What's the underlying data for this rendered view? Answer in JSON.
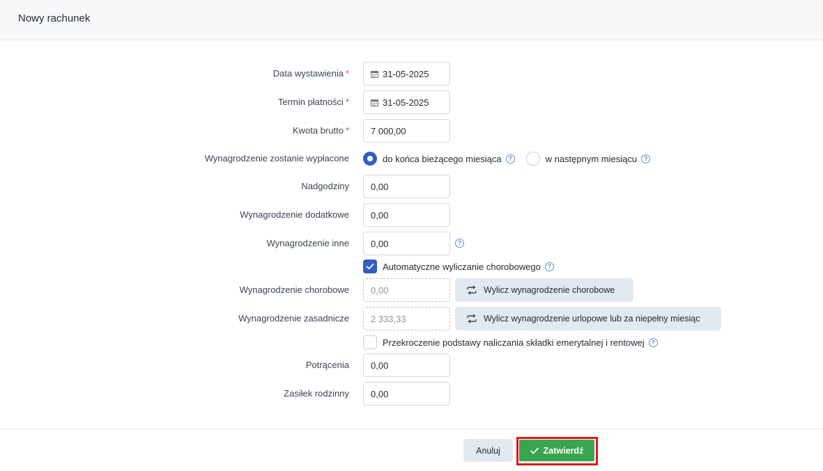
{
  "header": {
    "title": "Nowy rachunek"
  },
  "form": {
    "issue_date": {
      "label": "Data wystawienia",
      "required": "*",
      "value": "31-05-2025"
    },
    "due_date": {
      "label": "Termin płatności",
      "required": "*",
      "value": "31-05-2025"
    },
    "gross_amount": {
      "label": "Kwota brutto",
      "required": "*",
      "value": "7 000,00"
    },
    "payout": {
      "label": "Wynagrodzenie zostanie wypłacone",
      "options": [
        {
          "label": "do końca bieżącego miesiąca",
          "checked": true
        },
        {
          "label": "w następnym miesiącu",
          "checked": false
        }
      ]
    },
    "overtime": {
      "label": "Nadgodziny",
      "value": "0,00"
    },
    "additional_pay": {
      "label": "Wynagrodzenie dodatkowe",
      "value": "0,00"
    },
    "other_pay": {
      "label": "Wynagrodzenie inne",
      "value": "0,00"
    },
    "auto_sick_pay": {
      "label": "Automatyczne wyliczanie chorobowego",
      "checked": true
    },
    "sick_pay": {
      "label": "Wynagrodzenie chorobowe",
      "value": "0,00",
      "button": "Wylicz wynagrodzenie chorobowe"
    },
    "base_pay": {
      "label": "Wynagrodzenie zasadnicze",
      "value": "2 333,33",
      "button": "Wylicz wynagrodzenie urlopowe lub za niepełny miesiąc"
    },
    "contribution_limit": {
      "label": "Przekroczenie podstawy naliczania składki emerytalnej i rentowej",
      "checked": false
    },
    "deductions": {
      "label": "Potrącenia",
      "value": "0,00"
    },
    "family_allowance": {
      "label": "Zasiłek rodzinny",
      "value": "0,00"
    }
  },
  "footer": {
    "cancel_label": "Anuluj",
    "confirm_label": "Zatwierdź"
  },
  "colors": {
    "primary": "#2f5fc4",
    "confirm": "#38a651",
    "highlight": "#e2151b",
    "required": "#e0413a"
  },
  "icons": {
    "date": "calendar-icon",
    "help": "help-icon",
    "recalc": "refresh-icon",
    "confirm": "check-icon"
  },
  "help_text": "?"
}
